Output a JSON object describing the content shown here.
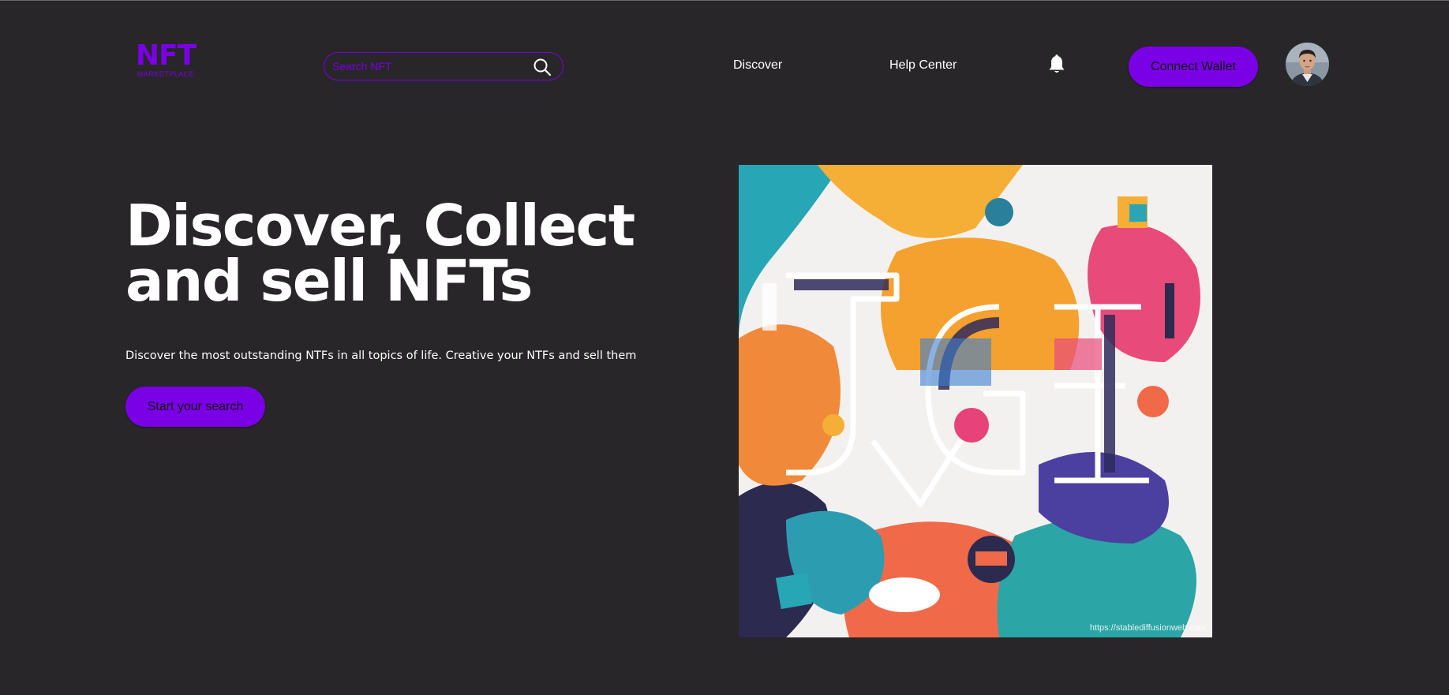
{
  "header": {
    "logo": {
      "main": "NFT",
      "sub": "MARKETPLACE"
    },
    "search": {
      "placeholder": "Search NFT",
      "value": "",
      "icon": "search-icon"
    },
    "nav": [
      {
        "label": "Discover"
      },
      {
        "label": "Help Center"
      }
    ],
    "notification_icon": "bell-icon",
    "connect_label": "Connect Wallet",
    "avatar_icon": "user-avatar"
  },
  "hero": {
    "title": "Discover, Collect and sell NFTs",
    "subtitle": "Discover the most outstanding NTFs in all topics of life. Creative your NTFs and sell them",
    "cta_label": "Start your search",
    "artwork": {
      "watermark": "https://stablediffusionweb.com"
    }
  },
  "theme": {
    "background": "#282628",
    "accent": "#7a00e6",
    "text": "#ffffff",
    "button_text": "#111111"
  }
}
